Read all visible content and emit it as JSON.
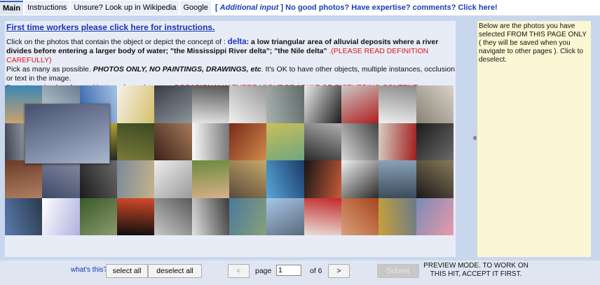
{
  "tabs": [
    {
      "label": "Main"
    },
    {
      "label": "Instructions"
    },
    {
      "label": "Unsure? Look up in Wikipedia"
    },
    {
      "label": "Google"
    }
  ],
  "additional_input": {
    "bracket_open": "[ ",
    "label": "Additional input",
    "bracket_close": " ]",
    "tail": " No good photos? Have expertise? comments? Click here!"
  },
  "main": {
    "instructions_link": "First time workers please click here for instructions.",
    "line1_prefix": "Click on the photos that contain the object or depict the concept of : ",
    "concept": "delta",
    "definition": ": a low triangular area of alluvial deposits where a river divides before entering a larger body of water; \"the Mississippi River delta\"; \"the Nile delta\"",
    "definition_note": " .(PLEASE READ DEFINITION CAREFULLY)",
    "line2_prefix": "Pick as many as possible. ",
    "line2_bold": "PHOTOS ONLY, NO PAINTINGS, DRAWINGS, etc",
    "line2_rest": ". It's OK to have other objects, multiple instances, occlusion or text in the image.",
    "warning": "Do not use back or forward button of your browser. OCCASIONALLY THERE MIGHT BE ADULT OR DISTURBING CONTENT."
  },
  "photos": [
    {
      "name": "egg-dome",
      "c1": "#c9a36b",
      "c2": "#3d86b8"
    },
    {
      "name": "shell",
      "c1": "#c8d4dc",
      "c2": "#6b7f92"
    },
    {
      "name": "blue-pattern",
      "c1": "#2f5ea8",
      "c2": "#a7c4e6"
    },
    {
      "name": "map-diagram",
      "c1": "#f4f2ea",
      "c2": "#d6c06a"
    },
    {
      "name": "machine-parts",
      "c1": "#3a3c44",
      "c2": "#8d949c"
    },
    {
      "name": "bicycle",
      "c1": "#e6e6e6",
      "c2": "#555"
    },
    {
      "name": "schematic",
      "c1": "#f2f2f2",
      "c2": "#9a9a9a"
    },
    {
      "name": "3d-building",
      "c1": "#a9b2b0",
      "c2": "#5f6a6a"
    },
    {
      "name": "white-car",
      "c1": "#ececec",
      "c2": "#1b1b1b"
    },
    {
      "name": "red-suv",
      "c1": "#c9c9c9",
      "c2": "#b21d1d"
    },
    {
      "name": "fixture",
      "c1": "#f0f0f0",
      "c2": "#8a8a8a"
    },
    {
      "name": "cat",
      "c1": "#8a8276",
      "c2": "#d8d2c8"
    },
    {
      "name": "silver-car",
      "c1": "#3d4150",
      "c2": "#cfd4db"
    },
    {
      "name": "blue-car",
      "c1": "#1d2c63",
      "c2": "#7d8fb9"
    },
    {
      "name": "yellow-car",
      "c1": "#e6cf3a",
      "c2": "#222"
    },
    {
      "name": "tall-grass",
      "c1": "#7a7a3a",
      "c2": "#3b4a22"
    },
    {
      "name": "dining-hall",
      "c1": "#3a2218",
      "c2": "#a7795a"
    },
    {
      "name": "line-drawing",
      "c1": "#fafafa",
      "c2": "#777"
    },
    {
      "name": "food",
      "c1": "#7a2a1a",
      "c2": "#d08a4a"
    },
    {
      "name": "delta-map",
      "c1": "#c9c05a",
      "c2": "#6fa67e"
    },
    {
      "name": "machine-tilt",
      "c1": "#2a2a2a",
      "c2": "#b0b0b0"
    },
    {
      "name": "sports-car",
      "c1": "#d9d9d9",
      "c2": "#444"
    },
    {
      "name": "portrait-dancer",
      "c1": "#d8cfc5",
      "c2": "#a01e1e"
    },
    {
      "name": "bw-figure",
      "c1": "#1b1b1b",
      "c2": "#6a6a6a"
    },
    {
      "name": "indoor-red",
      "c1": "#6b3b2a",
      "c2": "#b08060"
    },
    {
      "name": "canal",
      "c1": "#3a4a6a",
      "c2": "#8a8aa0"
    },
    {
      "name": "book-cover",
      "c1": "#1a1a1a",
      "c2": "#6b6b6b"
    },
    {
      "name": "delta-aerial",
      "c1": "#7a8a9a",
      "c2": "#c6b28a"
    },
    {
      "name": "document",
      "c1": "#eeeeee",
      "c2": "#9a9a9a"
    },
    {
      "name": "woman-smile",
      "c1": "#6a8a3a",
      "c2": "#d9b08a"
    },
    {
      "name": "collage",
      "c1": "#5a4a3a",
      "c2": "#c6a86a"
    },
    {
      "name": "miami-poster",
      "c1": "#58a8d8",
      "c2": "#1a3a6a"
    },
    {
      "name": "controller",
      "c1": "#151515",
      "c2": "#c85a3a"
    },
    {
      "name": "white-car-2",
      "c1": "#f2f2f2",
      "c2": "#2a2a2a"
    },
    {
      "name": "factory",
      "c1": "#8aa2b8",
      "c2": "#3a4a5a"
    },
    {
      "name": "cd-cover",
      "c1": "#1a1a1a",
      "c2": "#8a7a5a"
    },
    {
      "name": "lake-person",
      "c1": "#5a7ab0",
      "c2": "#2a3a4a"
    },
    {
      "name": "line-chart",
      "c1": "#ffffff",
      "c2": "#b0b0e0"
    },
    {
      "name": "trees-field",
      "c1": "#3a5a2a",
      "c2": "#8a9a6a"
    },
    {
      "name": "triangle-diagram",
      "c1": "#0e0e0e",
      "c2": "#d44a2a"
    },
    {
      "name": "jet-plane",
      "c1": "#c8c8c8",
      "c2": "#5a5a5a"
    },
    {
      "name": "silver-car-2",
      "c1": "#e2e2e2",
      "c2": "#3a3a3a"
    },
    {
      "name": "aerial-river",
      "c1": "#4a7a9a",
      "c2": "#8aa07a"
    },
    {
      "name": "airliner",
      "c1": "#a8c6e8",
      "c2": "#5a6a7a"
    },
    {
      "name": "red-room",
      "c1": "#e8e0d8",
      "c2": "#c22a2a"
    },
    {
      "name": "redhead",
      "c1": "#d9a07a",
      "c2": "#a8451e"
    },
    {
      "name": "wheat-field",
      "c1": "#c8a23a",
      "c2": "#6a7a8a"
    },
    {
      "name": "flamingo-flock",
      "c1": "#7a8ab8",
      "c2": "#e89aa8"
    }
  ],
  "overlay_thumb": {
    "name": "hatchback-car",
    "c1": "#44506e",
    "c2": "#aab6ce"
  },
  "sidebar": {
    "text": "Below are the photos you have selected FROM THIS PAGE ONLY ( they will be saved when you navigate to other pages ). Click to deselect."
  },
  "bottom": {
    "whats_this": "what's this?",
    "select_all": "select all",
    "deselect_all": "deselect all",
    "prev": "<",
    "page_label": "page",
    "page_value": "1",
    "of_label": "of 6",
    "next": ">",
    "submit": "Submit",
    "preview_mode": "PREVIEW MODE. TO WORK ON THIS HIT, ACCEPT IT FIRST."
  }
}
